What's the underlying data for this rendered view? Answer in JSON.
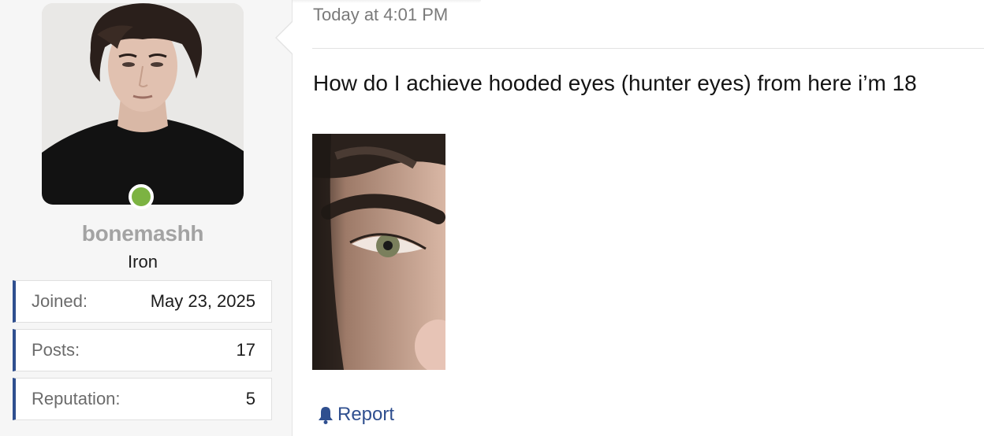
{
  "user": {
    "username": "bonemashh",
    "title": "Iron",
    "online": true,
    "online_color": "#7cb342",
    "stats": [
      {
        "label": "Joined:",
        "value": "May 23, 2025"
      },
      {
        "label": "Posts:",
        "value": "17"
      },
      {
        "label": "Reputation:",
        "value": "5"
      }
    ]
  },
  "post": {
    "timestamp": "Today at 4:01 PM",
    "text": "How do I achieve hooded eyes (hunter eyes) from here i’m 18",
    "report_label": "Report",
    "report_icon": "bell-icon"
  },
  "colors": {
    "accent": "#2f4f8f",
    "username": "#a3a3a3",
    "sidebar_bg": "#f6f6f6"
  }
}
